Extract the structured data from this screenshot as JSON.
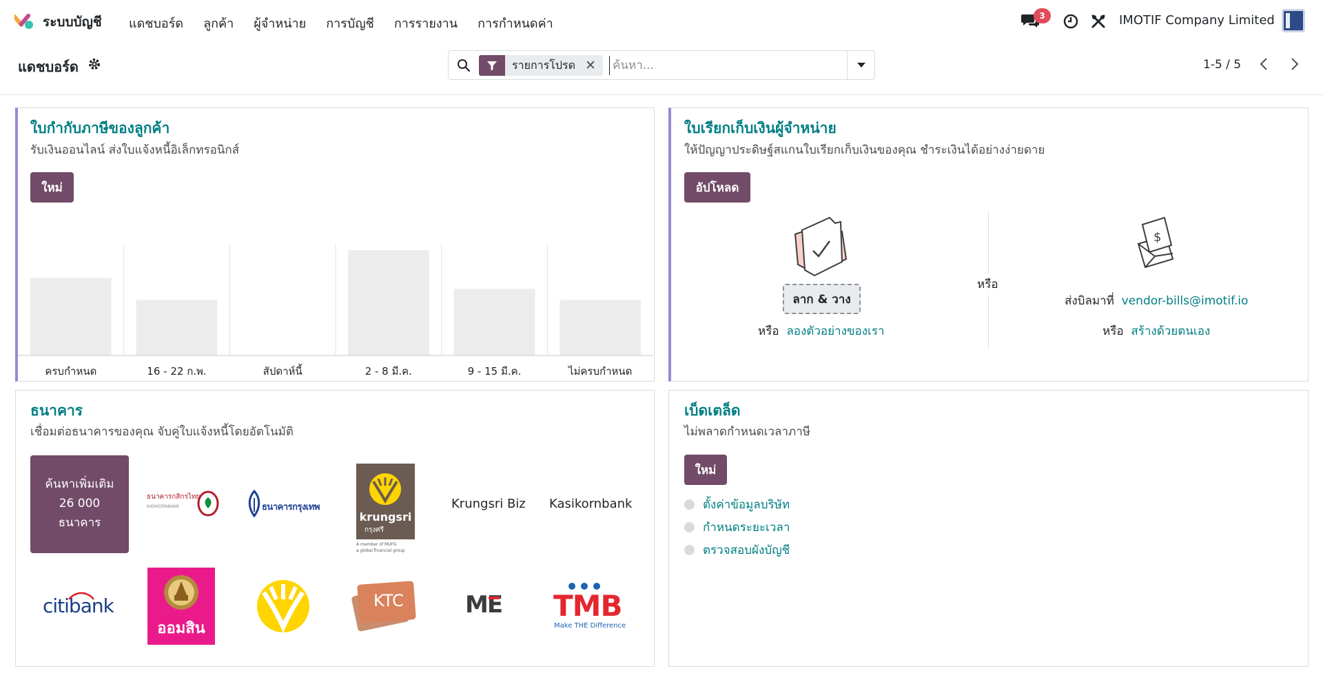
{
  "app": {
    "name": "ระบบบัญชี",
    "company": "IMOTIF Company Limited",
    "notification_count": "3"
  },
  "nav": {
    "items": [
      "แดชบอร์ด",
      "ลูกค้า",
      "ผู้จำหน่าย",
      "การบัญชี",
      "การรายงาน",
      "การกำหนดค่า"
    ]
  },
  "control_panel": {
    "title": "แดชบอร์ด",
    "facet_label": "รายการโปรด",
    "search_placeholder": "ค้นหา...",
    "pager": "1-5 / 5"
  },
  "invoices_card": {
    "title": "ใบกำกับภาษีของลูกค้า",
    "subtitle": "รับเงินออนไลน์ ส่งใบแจ้งหนี้อิเล็กทรอนิกส์",
    "button": "ใหม่"
  },
  "chart_data": {
    "type": "bar",
    "categories": [
      "ครบกำหนด",
      "16 - 22 ก.พ.",
      "สัปดาห์นี้",
      "2 - 8 มี.ค.",
      "9 - 15 มี.ค.",
      "ไม่ครบกำหนด"
    ],
    "values": [
      70,
      50,
      0,
      95,
      60,
      50
    ],
    "ylim": [
      0,
      100
    ],
    "bar_color": "#ececec"
  },
  "bills_card": {
    "title": "ใบเรียกเก็บเงินผู้จำหน่าย",
    "subtitle": "ให้ปัญญาประดิษฐ์สแกนใบเรียกเก็บเงินของคุณ ชำระเงินได้อย่างง่ายดาย",
    "button": "อัปโหลด",
    "drop_label": "ลาก & วาง",
    "or": "หรือ",
    "try_sample": "ลองตัวอย่างของเรา",
    "send_bill_to": "ส่งบิลมาที่",
    "email": "vendor-bills@imotif.io",
    "create_manually": "สร้างด้วยตนเอง"
  },
  "bank_card": {
    "title": "ธนาคาร",
    "subtitle": "เชื่อมต่อธนาคารของคุณ จับคู่ใบแจ้งหนี้โดยอัตโนมัติ",
    "search_more": [
      "ค้นหาเพิ่มเติม",
      "26 000",
      "ธนาคาร"
    ],
    "banks": {
      "kbank_th": "ธนาคารกสิกรไทย",
      "kbank_en": "KASIKORNBANK",
      "bbl": "ธนาคารกรุงเทพ",
      "krungsri": "krungsri",
      "krungsri_th": "กรุงศรี",
      "krungsri_tag1": "A member of MUFG",
      "krungsri_tag2": "a global financial group",
      "krungsri_biz": "Krungsri Biz",
      "kasikornbank": "Kasikornbank",
      "citibank": "citibank",
      "gsb": "ออมสิน",
      "ktc": "KTC",
      "me": "ME",
      "tmb": "TMB",
      "tmb_tag": "Make THE Difference"
    }
  },
  "tax_card": {
    "title": "เบ็ดเตล็ด",
    "subtitle": "ไม่พลาดกำหนดเวลาภาษี",
    "button": "ใหม่",
    "todos": [
      "ตั้งค่าข้อมูลบริษัท",
      "กำหนดระยะเวลา",
      "ตรวจสอบผังบัญชี"
    ]
  },
  "colors": {
    "primary": "#714b67",
    "link": "#017e84",
    "accent": "#9b87d8"
  }
}
